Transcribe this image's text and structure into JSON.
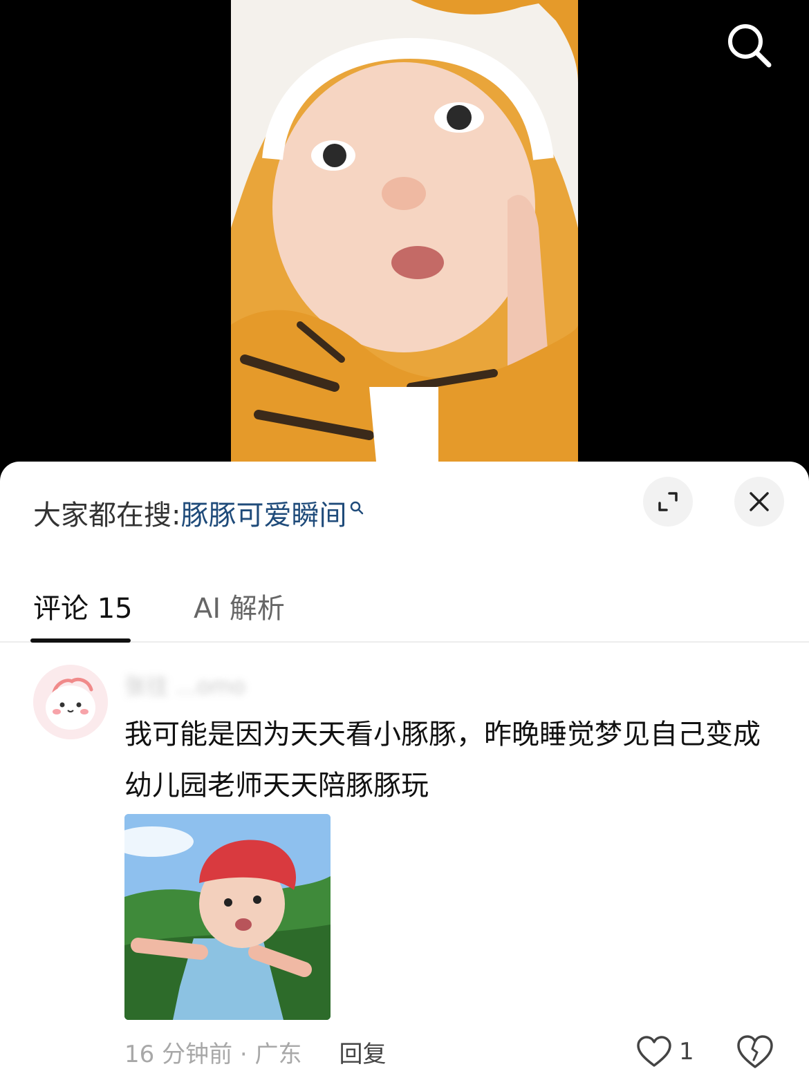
{
  "search_suggestion": {
    "prefix": "大家都在搜:",
    "term": "豚豚可爱瞬间"
  },
  "tabs": [
    {
      "label": "评论 15",
      "active": true
    },
    {
      "label": "AI 解析",
      "active": false
    }
  ],
  "comment": {
    "username": "张往 ...omo",
    "text": "我可能是因为天天看小豚豚，昨晚睡觉梦见自己变成幼儿园老师天天陪豚豚玩",
    "time_location": "16 分钟前 · 广东",
    "reply_label": "回复",
    "like_count": "1"
  },
  "icons": {
    "top_right": "search-icon",
    "expand": "expand-icon",
    "close": "close-icon",
    "like": "heart-outline-icon",
    "dislike": "broken-heart-icon"
  },
  "colors": {
    "search_term": "#1f4b7a",
    "sheet_background": "#ffffff",
    "video_background": "#000000"
  }
}
